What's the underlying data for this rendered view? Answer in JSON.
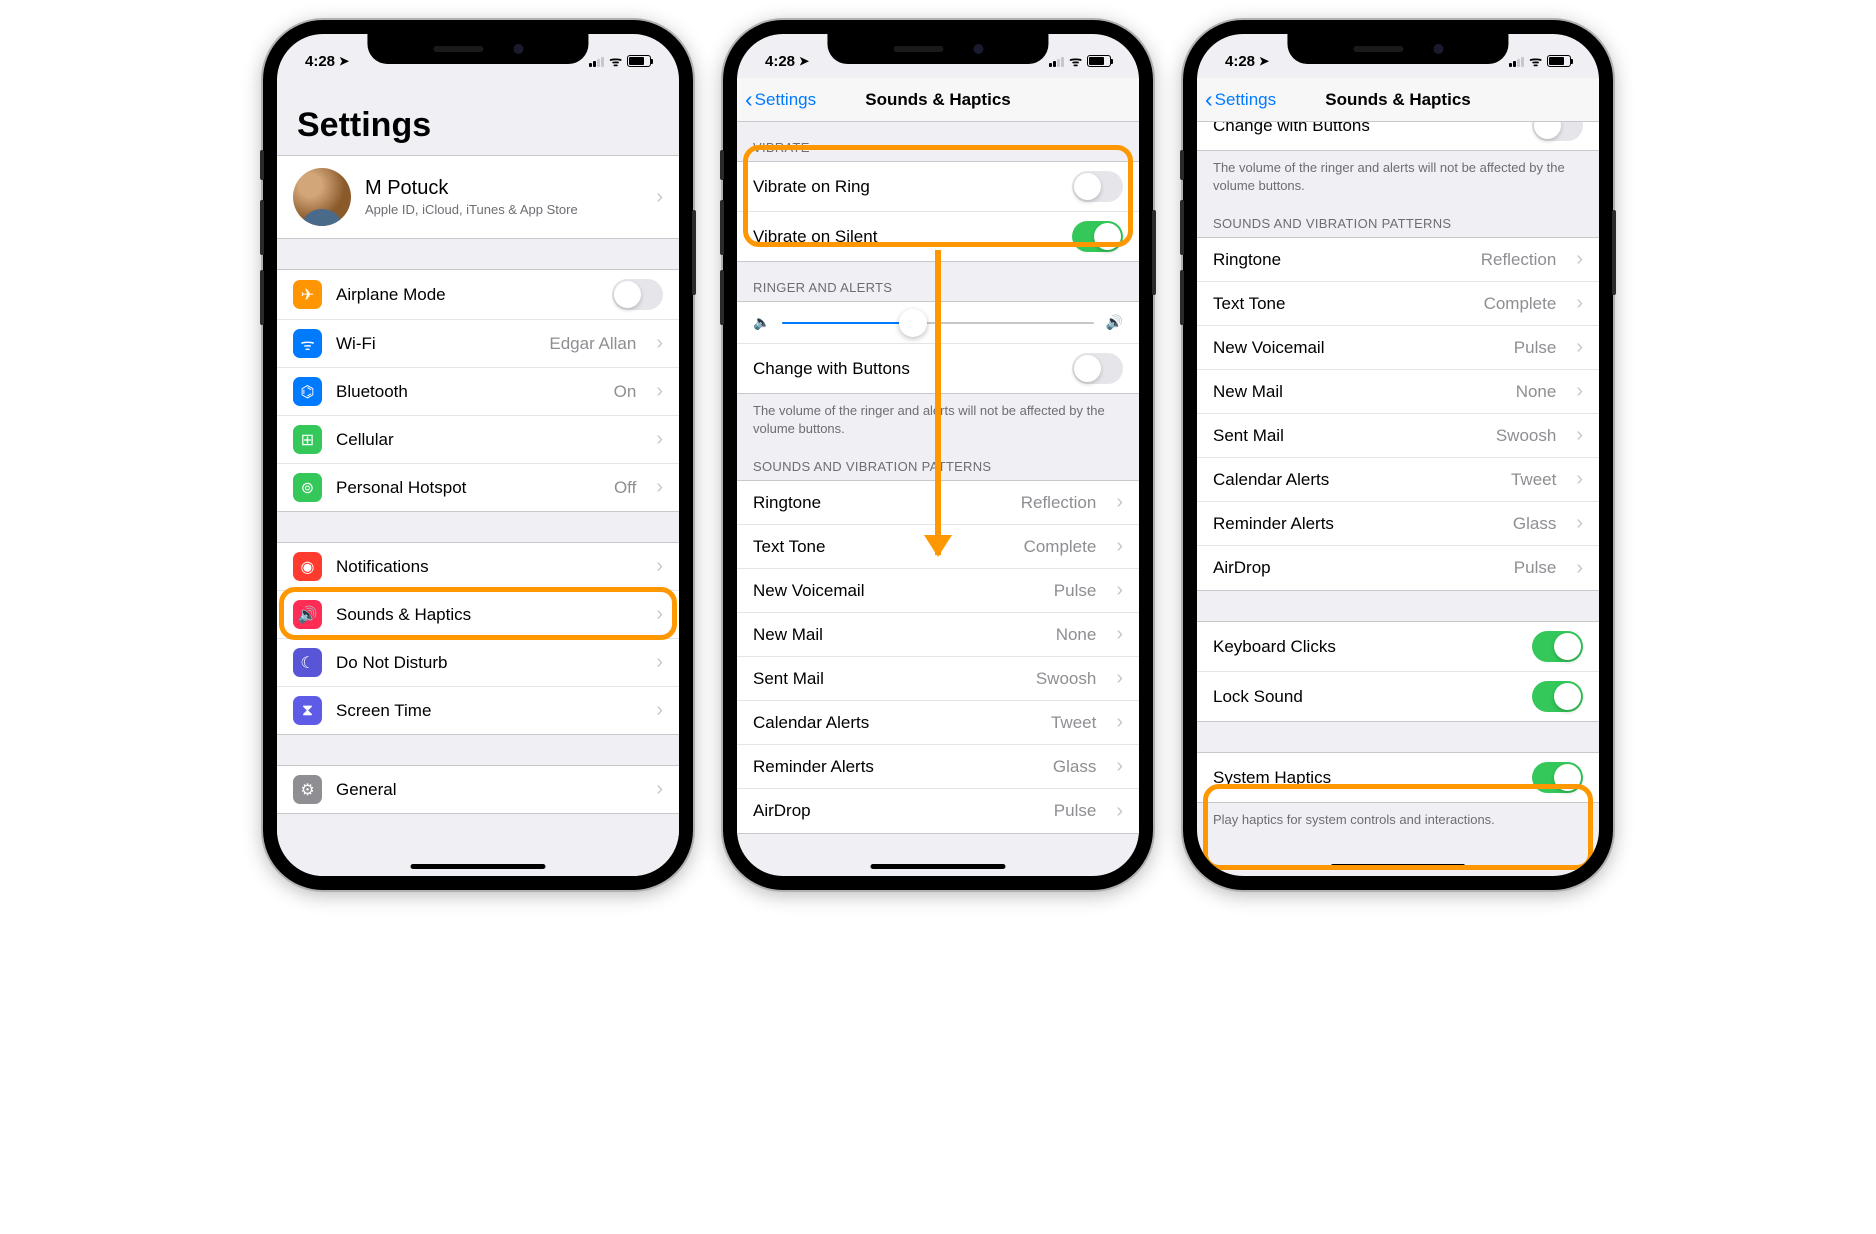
{
  "status": {
    "time": "4:28",
    "location_arrow": "➤"
  },
  "phone1": {
    "title": "Settings",
    "account": {
      "name": "M Potuck",
      "sub": "Apple ID, iCloud, iTunes & App Store"
    },
    "groupA": [
      {
        "icon": "airplane-icon",
        "color": "ib-orange",
        "glyph": "✈",
        "label": "Airplane Mode",
        "toggle": false
      },
      {
        "icon": "wifi-icon",
        "color": "ib-blue",
        "glyph": "ᯤ",
        "label": "Wi-Fi",
        "detail": "Edgar Allan"
      },
      {
        "icon": "bluetooth-icon",
        "color": "ib-blue",
        "glyph": "⌬",
        "label": "Bluetooth",
        "detail": "On"
      },
      {
        "icon": "cellular-icon",
        "color": "ib-green",
        "glyph": "⊞",
        "label": "Cellular",
        "detail": ""
      },
      {
        "icon": "hotspot-icon",
        "color": "ib-green",
        "glyph": "⊚",
        "label": "Personal Hotspot",
        "detail": "Off"
      }
    ],
    "groupB": [
      {
        "icon": "notifications-icon",
        "color": "ib-red",
        "glyph": "◉",
        "label": "Notifications"
      },
      {
        "icon": "sounds-icon",
        "color": "ib-pink",
        "glyph": "🔊",
        "label": "Sounds & Haptics",
        "highlight": true
      },
      {
        "icon": "dnd-icon",
        "color": "ib-purple",
        "glyph": "☾",
        "label": "Do Not Disturb"
      },
      {
        "icon": "screentime-icon",
        "color": "ib-indigo",
        "glyph": "⧗",
        "label": "Screen Time"
      }
    ],
    "groupC": [
      {
        "icon": "general-icon",
        "color": "ib-gray",
        "glyph": "⚙",
        "label": "General"
      }
    ]
  },
  "phone2": {
    "back": "Settings",
    "title": "Sounds & Haptics",
    "vibrate_header": "VIBRATE",
    "vibrate": [
      {
        "label": "Vibrate on Ring",
        "on": false
      },
      {
        "label": "Vibrate on Silent",
        "on": true
      }
    ],
    "ringer_header": "RINGER AND ALERTS",
    "slider_value": 0.42,
    "change_buttons": {
      "label": "Change with Buttons",
      "on": false
    },
    "ringer_footer": "The volume of the ringer and alerts will not be affected by the volume buttons.",
    "patterns_header": "SOUNDS AND VIBRATION PATTERNS",
    "patterns": [
      {
        "label": "Ringtone",
        "detail": "Reflection"
      },
      {
        "label": "Text Tone",
        "detail": "Complete"
      },
      {
        "label": "New Voicemail",
        "detail": "Pulse"
      },
      {
        "label": "New Mail",
        "detail": "None"
      },
      {
        "label": "Sent Mail",
        "detail": "Swoosh"
      },
      {
        "label": "Calendar Alerts",
        "detail": "Tweet"
      },
      {
        "label": "Reminder Alerts",
        "detail": "Glass"
      },
      {
        "label": "AirDrop",
        "detail": "Pulse"
      }
    ]
  },
  "phone3": {
    "back": "Settings",
    "title": "Sounds & Haptics",
    "cut_row": {
      "label": "Change with Buttons",
      "on": false
    },
    "ringer_footer": "The volume of the ringer and alerts will not be affected by the volume buttons.",
    "patterns_header": "SOUNDS AND VIBRATION PATTERNS",
    "patterns": [
      {
        "label": "Ringtone",
        "detail": "Reflection"
      },
      {
        "label": "Text Tone",
        "detail": "Complete"
      },
      {
        "label": "New Voicemail",
        "detail": "Pulse"
      },
      {
        "label": "New Mail",
        "detail": "None"
      },
      {
        "label": "Sent Mail",
        "detail": "Swoosh"
      },
      {
        "label": "Calendar Alerts",
        "detail": "Tweet"
      },
      {
        "label": "Reminder Alerts",
        "detail": "Glass"
      },
      {
        "label": "AirDrop",
        "detail": "Pulse"
      }
    ],
    "clicks": [
      {
        "label": "Keyboard Clicks",
        "on": true
      },
      {
        "label": "Lock Sound",
        "on": true
      }
    ],
    "system": {
      "label": "System Haptics",
      "on": true
    },
    "system_footer": "Play haptics for system controls and interactions."
  }
}
